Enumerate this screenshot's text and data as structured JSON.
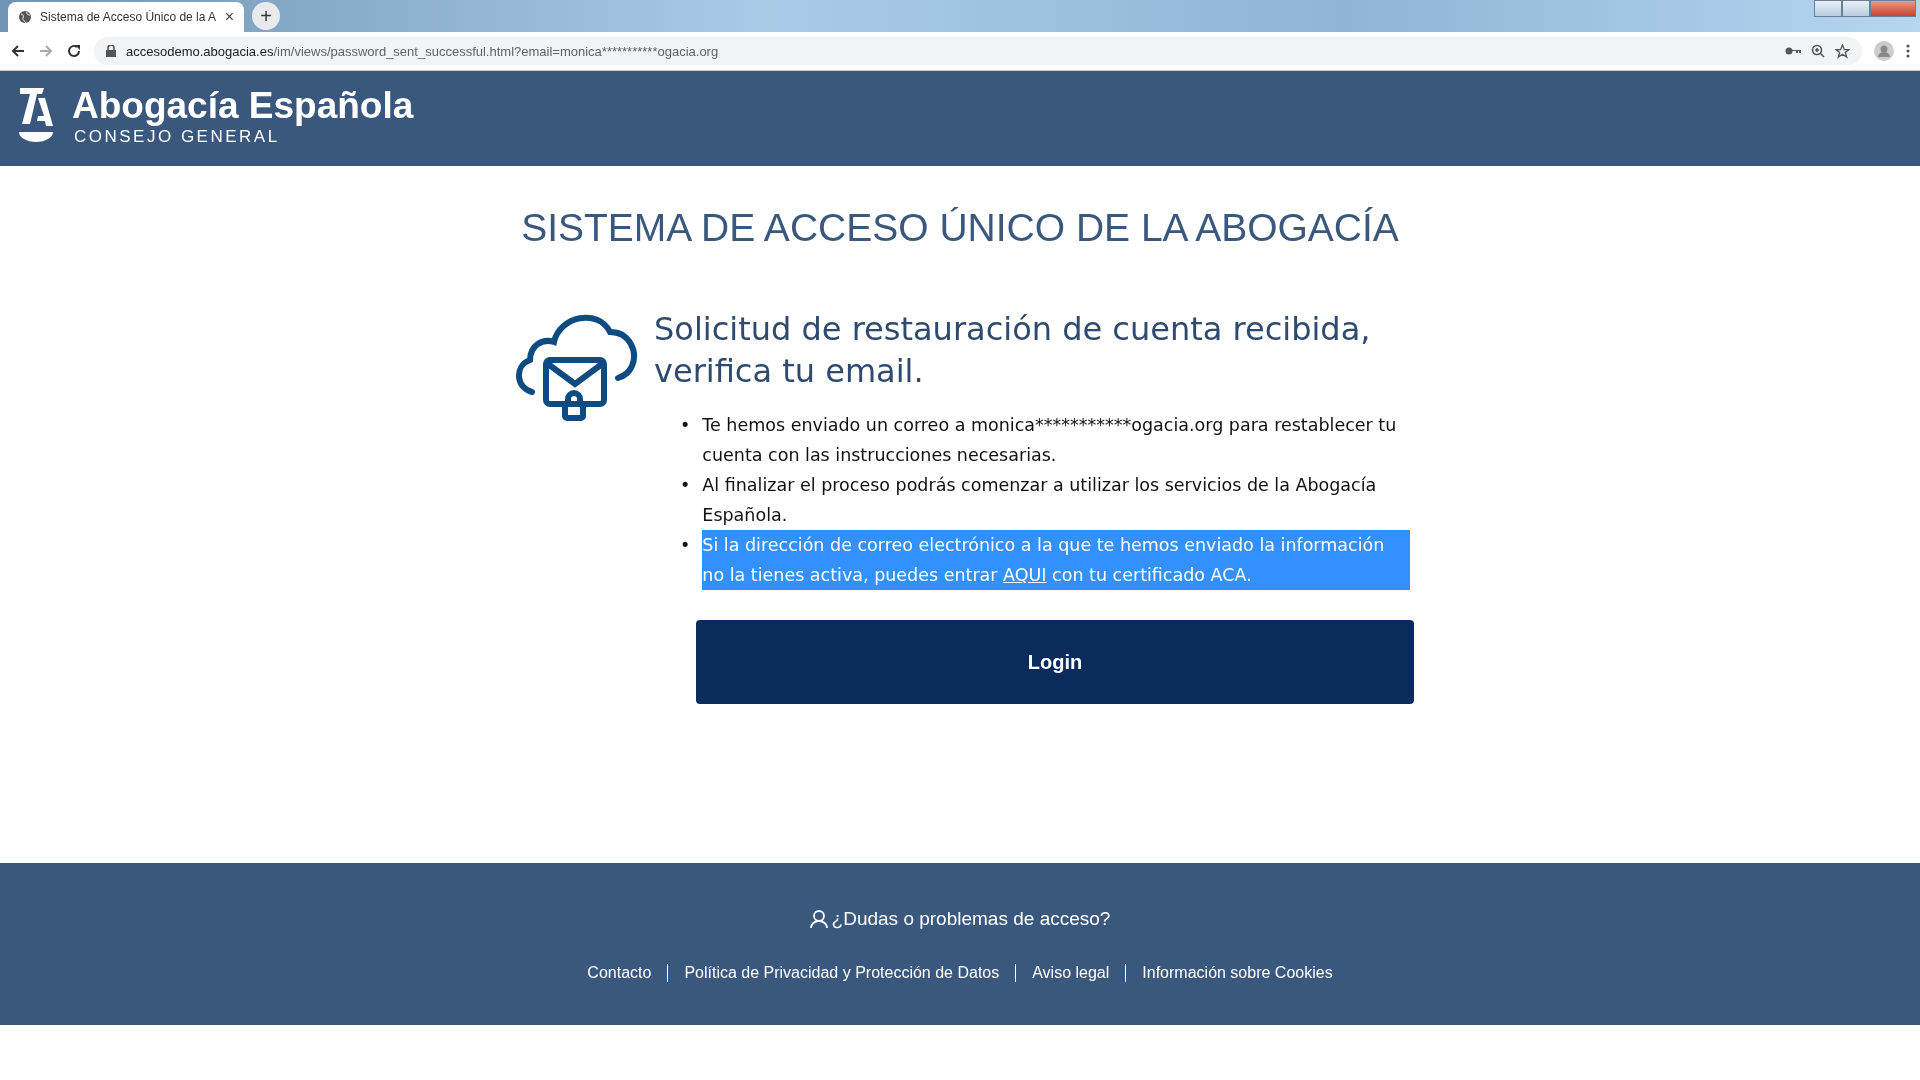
{
  "browser": {
    "tab": {
      "title": "Sistema de Acceso Único de la A",
      "selected": true
    },
    "new_tab": "+",
    "close_tab": "×",
    "url_host": "accesodemo.abogacia.es",
    "url_path": "/im/views/password_sent_successful.html?email=monica***********ogacia.org"
  },
  "header": {
    "brand": "Abogacía Española",
    "subtitle": "CONSEJO GENERAL"
  },
  "page_title": "SISTEMA DE ACCESO ÚNICO DE LA ABOGACÍA",
  "message": {
    "heading": "Solicitud de restauración de cuenta recibida, verifica tu email.",
    "bullets": [
      {
        "marker": "•",
        "text": "Te hemos enviado un correo a monica***********ogacia.org para restablecer tu cuenta con las instrucciones necesarias.",
        "highlighted": false
      },
      {
        "marker": "•",
        "text": "Al finalizar el proceso podrás comenzar a utilizar los servicios de la Abogacía Española.",
        "highlighted": false
      },
      {
        "marker": "•",
        "text": "Si la dirección de correo electrónico a la que te hemos enviado la información no la tienes activa, puedes entrar ",
        "link": "AQUI",
        "text_after": " con tu certificado ACA.",
        "highlighted": true
      }
    ],
    "button": "Login"
  },
  "footer": {
    "help": "¿Dudas o problemas de acceso?",
    "links": [
      "Contacto",
      "Política de Privacidad y Protección de Datos",
      "Aviso legal",
      "Información sobre Cookies"
    ]
  }
}
